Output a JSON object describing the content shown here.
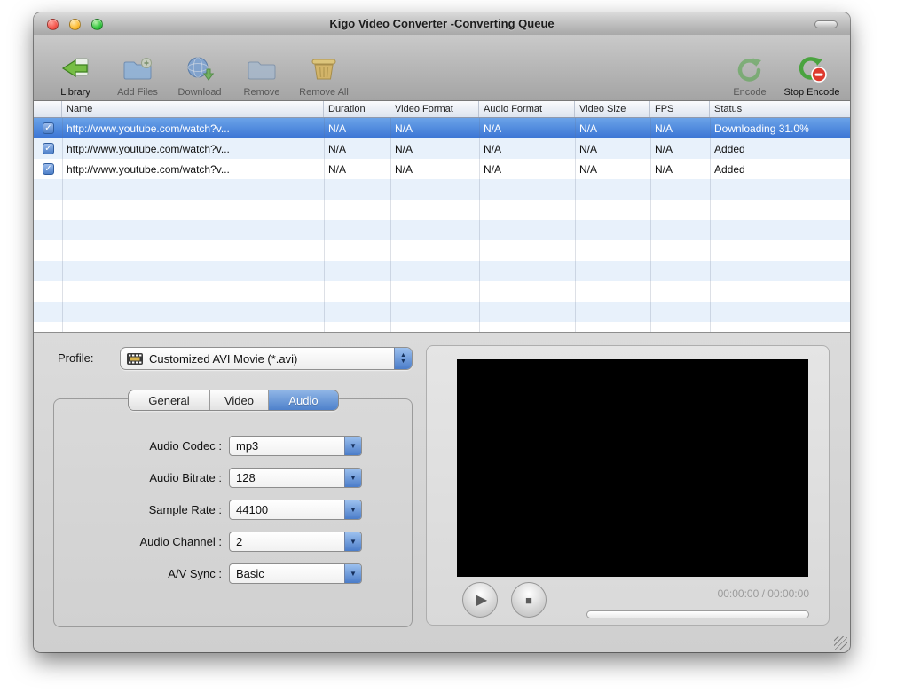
{
  "window": {
    "title": "Kigo Video Converter -Converting Queue"
  },
  "toolbar": {
    "left": [
      {
        "label": "Library"
      },
      {
        "label": "Add Files"
      },
      {
        "label": "Download"
      },
      {
        "label": "Remove"
      },
      {
        "label": "Remove All"
      }
    ],
    "right": [
      {
        "label": "Encode"
      },
      {
        "label": "Stop Encode"
      }
    ]
  },
  "table": {
    "columns": {
      "name": "Name",
      "duration": "Duration",
      "video_format": "Video Format",
      "audio_format": "Audio Format",
      "video_size": "Video Size",
      "fps": "FPS",
      "status": "Status"
    },
    "rows": [
      {
        "checked": true,
        "selected": true,
        "name": "http://www.youtube.com/watch?v...",
        "duration": "N/A",
        "video_format": "N/A",
        "audio_format": "N/A",
        "video_size": "N/A",
        "fps": "N/A",
        "status": "Downloading 31.0%"
      },
      {
        "checked": true,
        "selected": false,
        "name": "http://www.youtube.com/watch?v...",
        "duration": "N/A",
        "video_format": "N/A",
        "audio_format": "N/A",
        "video_size": "N/A",
        "fps": "N/A",
        "status": "Added"
      },
      {
        "checked": true,
        "selected": false,
        "name": "http://www.youtube.com/watch?v...",
        "duration": "N/A",
        "video_format": "N/A",
        "audio_format": "N/A",
        "video_size": "N/A",
        "fps": "N/A",
        "status": "Added"
      }
    ]
  },
  "profile": {
    "label": "Profile:",
    "value": "Customized AVI Movie (*.avi)"
  },
  "tabs": {
    "general": "General",
    "video": "Video",
    "audio": "Audio",
    "active": "Audio"
  },
  "settings": {
    "audio_codec": {
      "label": "Audio Codec :",
      "value": "mp3"
    },
    "audio_bitrate": {
      "label": "Audio Bitrate :",
      "value": "128"
    },
    "sample_rate": {
      "label": "Sample Rate :",
      "value": "44100"
    },
    "audio_channel": {
      "label": "Audio Channel :",
      "value": "2"
    },
    "av_sync": {
      "label": "A/V Sync :",
      "value": "Basic"
    }
  },
  "preview": {
    "time": "00:00:00 / 00:00:00"
  },
  "colors": {
    "selection": "#3a74d4",
    "row_stripe": "#e8f1fb",
    "tab_active": "#4e81cb",
    "stepper_blue": "#4a7cc9"
  }
}
